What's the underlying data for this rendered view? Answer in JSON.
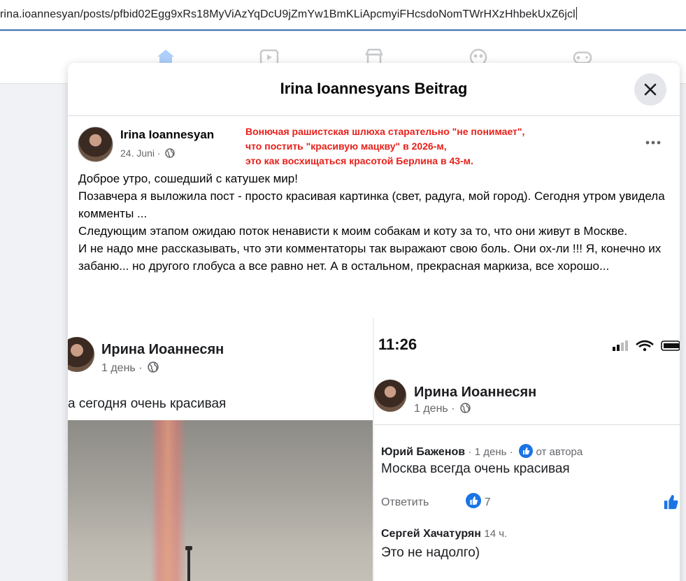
{
  "browser": {
    "url": "rina.ioannesyan/posts/pfbid02Egg9xRs18MyViAzYqDcU9jZmYw1BmKLiApcmyiFHcsdoNomTWrHXzHhbekUxZ6jcl"
  },
  "nav_icons": [
    "home-icon",
    "video-icon",
    "marketplace-icon",
    "groups-icon",
    "gaming-icon"
  ],
  "modal": {
    "title": "Irina Ioannesyans Beitrag",
    "close_icon": "close-icon"
  },
  "post": {
    "author": "Irina Ioannesyan",
    "date": "24. Juni ·",
    "annotation": {
      "color": "#e8201a",
      "lines": [
        "Вонючая рашистская шлюха старательно \"не понимает\",",
        "что постить \"красивую мацкву\" в 2026-м,",
        "это как восхищаться красотой Берлина в 43-м."
      ]
    },
    "text": [
      "Доброе утро, сошедший с катушек мир!",
      "Позавчера я выложила пост - просто красивая картинка (свет, радуга, мой город). Сегодня утром увидела комменты ...",
      "Следующим этапом ожидаю поток ненависти к моим собакам и коту за то, что они живут в Москве.",
      "И не надо мне рассказывать, что эти комментаторы так выражают свою боль. Они ох-ли !!!  Я, конечно их забаню... но другого глобуса а все равно нет. А в остальном, прекрасная маркиза, все хорошо..."
    ]
  },
  "left_screenshot": {
    "name": "Ирина Иоаннесян",
    "meta": "1 день ·",
    "text": "а сегодня очень красивая"
  },
  "right_screenshot": {
    "time": "11:26",
    "name": "Ирина Иоаннесян",
    "meta": "1 день ·",
    "comments": [
      {
        "author": "Юрий Баженов",
        "meta": "· 1 день ·",
        "badge": "от автора",
        "text": "Москва всегда очень красивая",
        "reply": "Ответить",
        "likes": "7"
      },
      {
        "author": "Сергей Хачатурян",
        "meta": "14 ч.",
        "text": "Это не надолго)"
      }
    ]
  },
  "colors": {
    "accent": "#1b74e4",
    "url_underline": "#3f6fb5"
  }
}
